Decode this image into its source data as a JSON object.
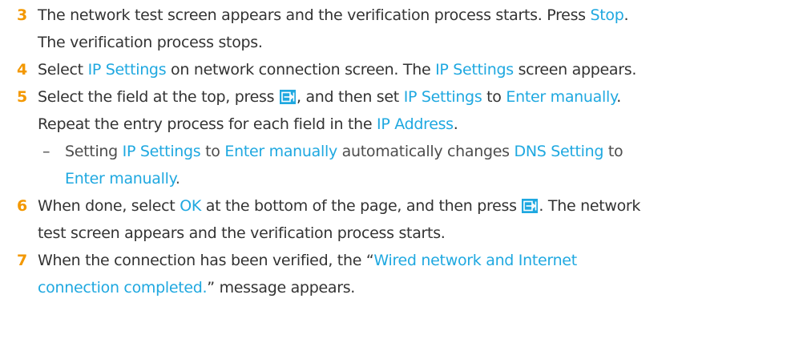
{
  "steps": [
    {
      "number": "3",
      "line1": [
        "The network test screen appears and the verification process starts. Press ",
        "Stop",
        "."
      ],
      "line2": "The verification process stops."
    },
    {
      "number": "4",
      "parts": [
        "Select ",
        "IP Settings",
        " on network connection screen. The ",
        "IP Settings",
        " screen appears."
      ]
    },
    {
      "number": "5",
      "line1": [
        "Select the field at the top, press ",
        ", and then set ",
        "IP Settings",
        " to ",
        "Enter manually",
        "."
      ],
      "line2": [
        "Repeat the entry process for each field in the ",
        "IP Address",
        "."
      ],
      "sub": {
        "dash": "–",
        "line1": [
          "Setting ",
          "IP Settings",
          " to ",
          "Enter manually",
          " automatically changes ",
          "DNS Setting",
          " to"
        ],
        "line2": [
          "Enter manually",
          "."
        ]
      }
    },
    {
      "number": "6",
      "line1": [
        "When done, select ",
        "OK",
        " at the bottom of the page, and then press ",
        ". The network"
      ],
      "line2": "test screen appears and the verification process starts."
    },
    {
      "number": "7",
      "line1": [
        "When the connection has been verified, the “",
        "Wired network and Internet"
      ],
      "line2": [
        "connection completed.",
        "” message appears."
      ]
    }
  ],
  "icons": {
    "enter": "enter-icon"
  },
  "colors": {
    "highlight": "#1fa8e0",
    "step_number": "#f39800",
    "text": "#333333"
  }
}
